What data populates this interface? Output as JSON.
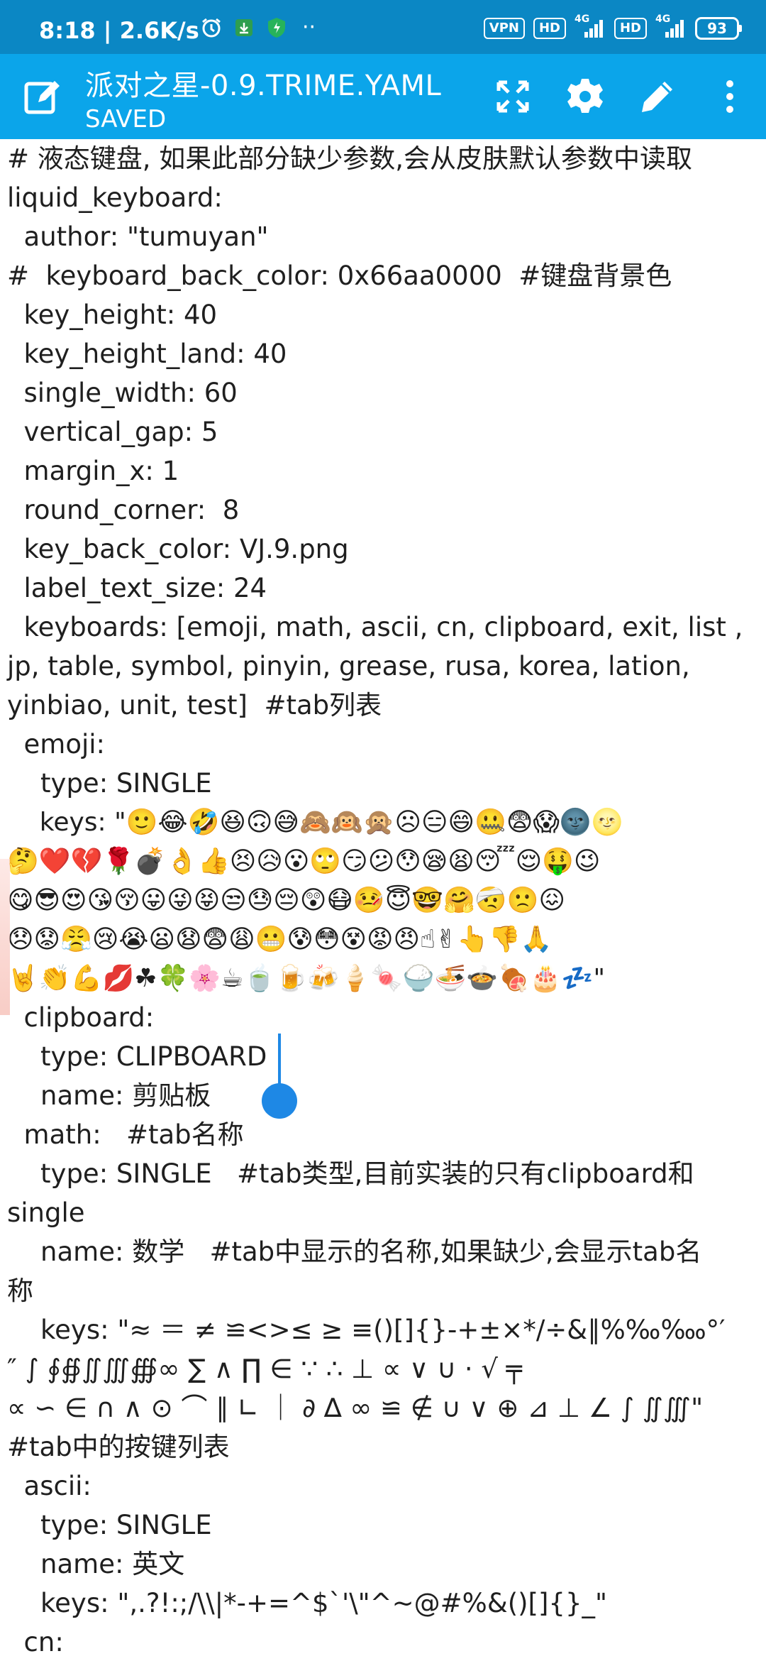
{
  "status_bar": {
    "time_speed": "8:18 | 2.6K/s",
    "more_dots": "··",
    "vpn": "VPN",
    "hd1": "HD",
    "net1": "4G",
    "hd2": "HD",
    "net2": "4G",
    "battery": "93"
  },
  "app_bar": {
    "title": "派对之星-0.9.TRIME.YAML",
    "subtitle": "SAVED"
  },
  "icons": {
    "edit_doc": "edit-document-icon",
    "fullscreen": "fullscreen-icon",
    "settings": "settings-icon",
    "pencil": "pencil-icon",
    "more": "more-vert-icon"
  },
  "editor": {
    "lines": [
      "# 液态键盘, 如果此部分缺少参数,会从皮肤默认参数中读取",
      "liquid_keyboard:",
      "  author: \"tumuyan\"",
      "#  keyboard_back_color: 0x66aa0000  #键盘背景色",
      "  key_height: 40",
      "  key_height_land: 40",
      "  single_width: 60",
      "  vertical_gap: 5",
      "  margin_x: 1",
      "  round_corner:  8",
      "  key_back_color: VJ.9.png",
      "  label_text_size: 24",
      "  keyboards: [emoji, math, ascii, cn, clipboard, exit, list ,",
      "jp, table, symbol, pinyin, grease, rusa, korea, lation,",
      "yinbiao, unit, test]  #tab列表",
      "  emoji:",
      "    type: SINGLE",
      "    keys: \"🙂😂🤣😆🙃😅🙈🙉🙊☹😑😄🤐😨😱🌚🌝",
      "🤔❤️💔🌹💣👌👍😣😥😮🙄😏😕😯😪😫😴😌🤑😉",
      "😋😎😍😘😚😛😜😝😒😓😔😲😷🤒😇🤓🤗🤕🙁😖",
      "😞😟😤😢😭😦😧😨😩😬😰😳😵😡😠☝✌👆👎🙏",
      "🤘👏💪💋☘🍀🌸☕🍵🍺🍻🍦🍬🍚🍜🍲🍖🎂💤\"",
      "  clipboard:",
      "    type: CLIPBOARD",
      "    name: 剪贴板",
      "  math:   #tab名称",
      "    type: SINGLE   #tab类型,目前实装的只有clipboard和",
      "single",
      "    name: 数学   #tab中显示的名称,如果缺少,会显示tab名",
      "称",
      "    keys: \"≈ ＝ ≠ ≌<>≤ ≥ ≡()[]{}-+±×*/÷&∥%‰‱°′",
      "″ ∫ ∮∯∬∭∰∞ ∑ ∧ ∏ ∈ ∵ ∴ ⊥ ∝ ∨ ∪ · √ ╤",
      "∝ ∽ ∈ ∩ ∧ ⊙ ⌒ ∥ ∟ ｜ ∂ ∆ ∞ ≌ ∉ ∪ ∨ ⊕ ⊿ ⊥ ∠ ∫ ∬∭\"",
      "#tab中的按键列表",
      "  ascii:",
      "    type: SINGLE",
      "    name: 英文",
      "    keys: \",.?!:;/\\\\|*-+=^$`'\\\"^~@#%&()[]{}_\"",
      "  cn:"
    ]
  }
}
